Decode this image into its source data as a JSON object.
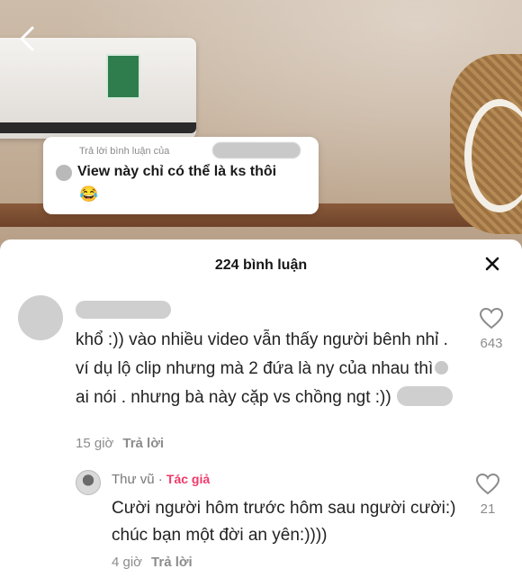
{
  "video": {
    "reply_header": "Trả lời bình luận của",
    "reply_text": "View này chỉ có thể là ks thôi",
    "reply_emoji": "😂"
  },
  "sheet": {
    "title": "224 bình luận"
  },
  "comment": {
    "text_1": "khổ :)) vào nhiều video vẫn thấy người bênh nhỉ . ví dụ lộ clip nhưng mà 2 đứa là ny của nhau thì",
    "text_2": "ai nói . nhưng bà này cặp vs chồng ngt :))",
    "time": "15 giờ",
    "reply_label": "Trả lời",
    "likes": "643"
  },
  "reply": {
    "name": "Thư vũ",
    "separator": " · ",
    "author_badge": "Tác giả",
    "text": "Cười người hôm trước hôm sau người cười:) chúc bạn một đời an yên:))))",
    "time": "4 giờ",
    "reply_label": "Trả lời",
    "likes": "21"
  }
}
